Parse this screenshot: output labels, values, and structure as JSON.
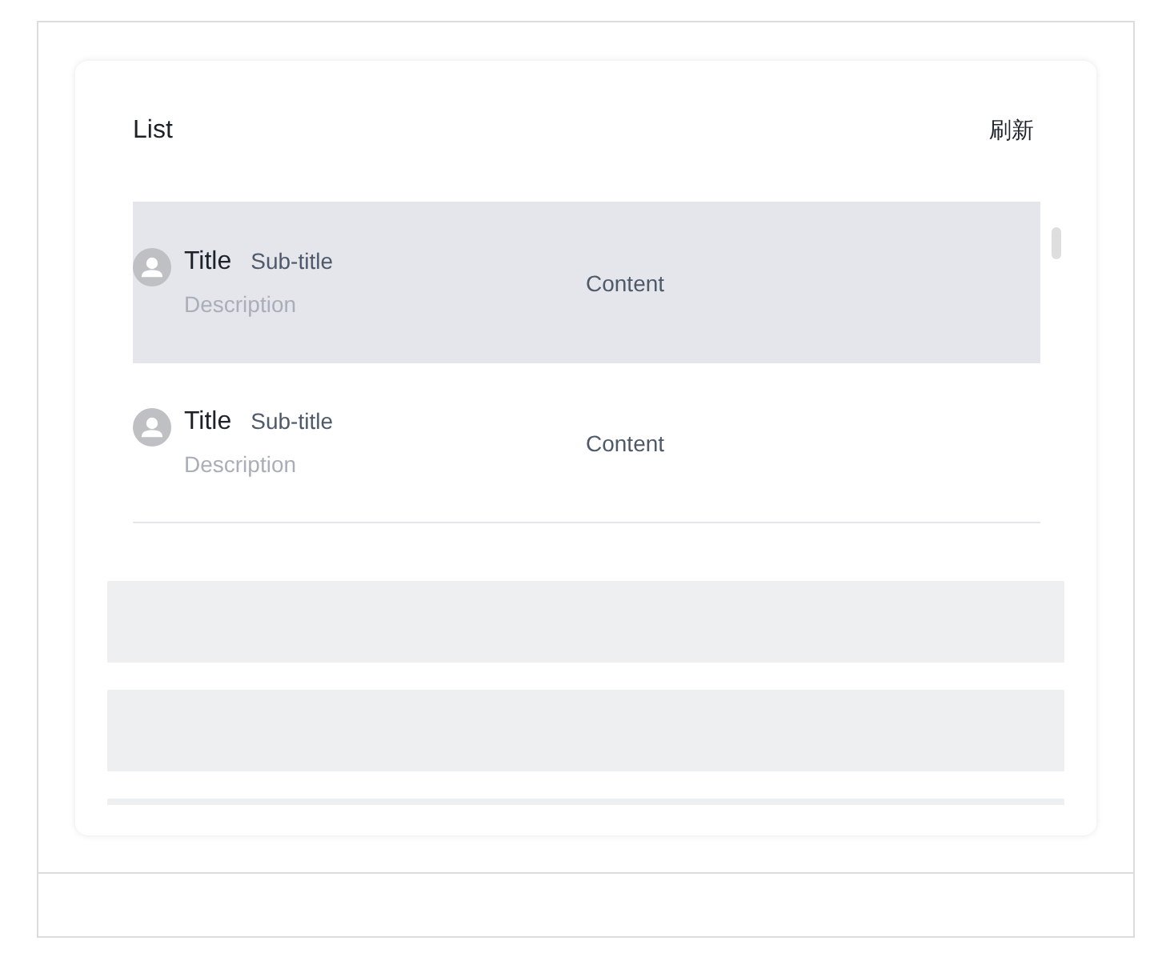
{
  "card": {
    "title": "List",
    "action": "刷新"
  },
  "list": {
    "items": [
      {
        "title": "Title",
        "subtitle": "Sub-title",
        "description": "Description",
        "content": "Content",
        "highlighted": true
      },
      {
        "title": "Title",
        "subtitle": "Sub-title",
        "description": "Description",
        "content": "Content",
        "highlighted": false
      }
    ]
  },
  "placeholders": [
    {
      "kind": "skeleton"
    },
    {
      "kind": "skeleton"
    },
    {
      "kind": "skeleton"
    }
  ]
}
